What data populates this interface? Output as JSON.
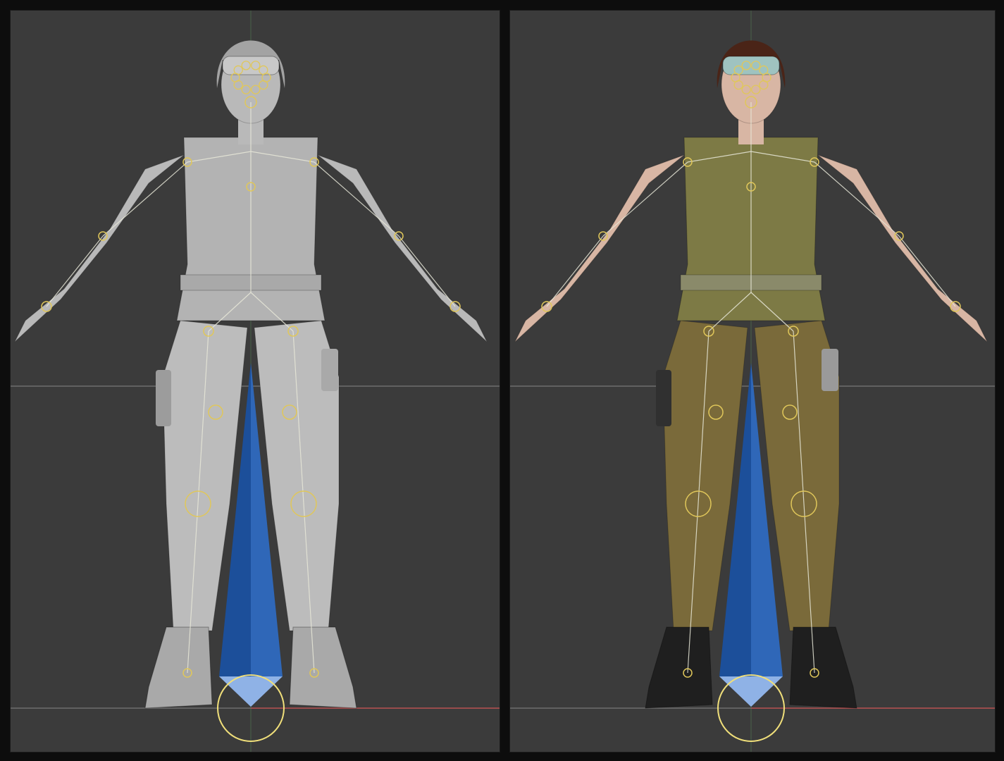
{
  "viewports": [
    {
      "name": "viewport-clay-shading",
      "mode": "solid",
      "body_color": "#b9b9b9",
      "skin_color": "#b9b9b9",
      "top_color": "#b3b3b3",
      "pants_color": "#bcbcbc",
      "boot_color": "#a9a9a9",
      "hair_color": "#a3a3a3"
    },
    {
      "name": "viewport-textured-shading",
      "mode": "textured",
      "body_color": "#c9a591",
      "skin_color": "#d8b6a4",
      "top_color": "#7d7a45",
      "pants_color": "#7a6a3a",
      "boot_color": "#1f1f1f",
      "hair_color": "#4a2417"
    }
  ],
  "colors": {
    "viewport_bg": "#3b3b3b",
    "grid_line": "#6e6e6e",
    "x_axis": "#b04a4a",
    "y_axis": "#5a8a5a",
    "root_bone": "#1c4f9a",
    "root_bone_tip": "#8fb2e6",
    "bone_wire": "#e8e8d8",
    "joint_circle": "#e0c75a"
  }
}
